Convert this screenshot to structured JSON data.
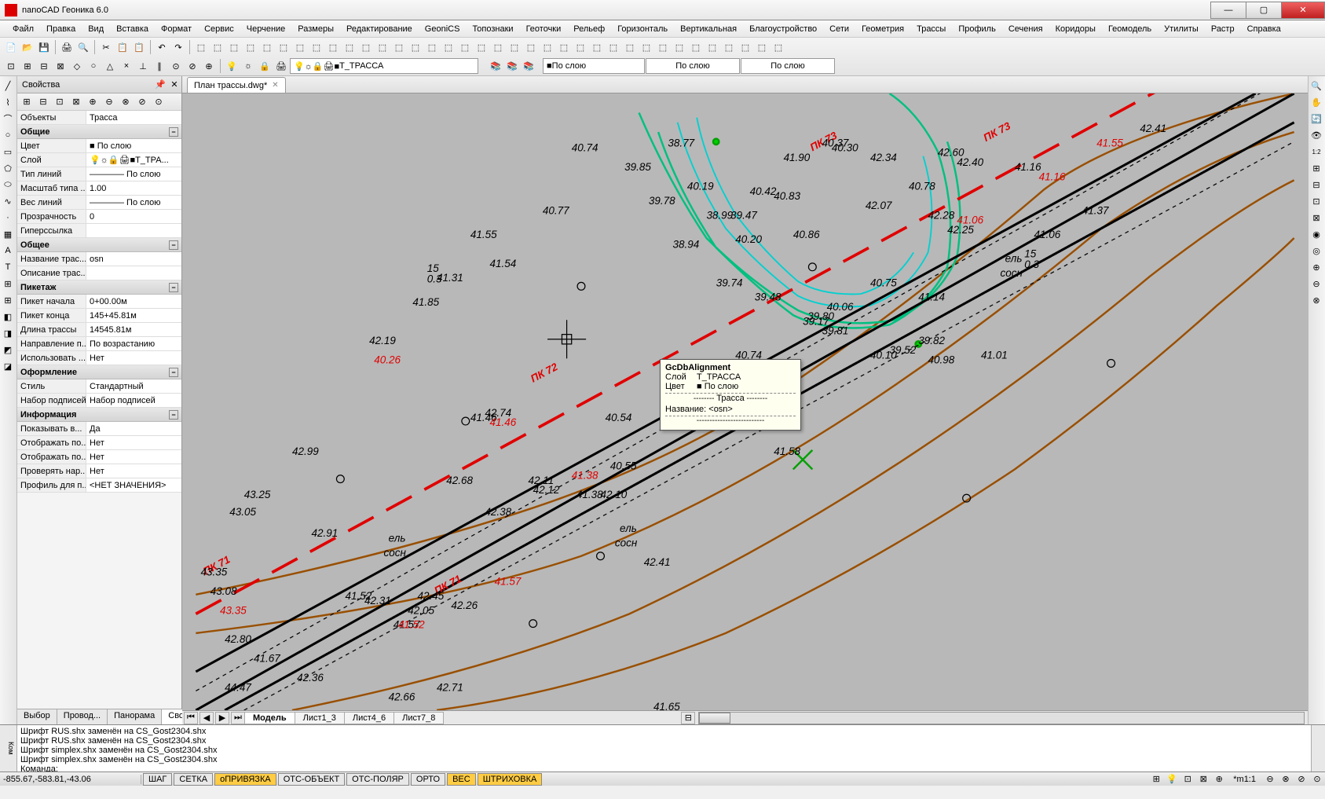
{
  "app": {
    "title": "nanoCAD Геоника 6.0"
  },
  "menu": [
    "Файл",
    "Правка",
    "Вид",
    "Вставка",
    "Формат",
    "Сервис",
    "Черчение",
    "Размеры",
    "Редактирование",
    "GeoniCS",
    "Топознаки",
    "Геоточки",
    "Рельеф",
    "Горизонталь",
    "Вертикальная",
    "Благоустройство",
    "Сети",
    "Геометрия",
    "Трассы",
    "Профиль",
    "Сечения",
    "Коридоры",
    "Геомодель",
    "Утилиты",
    "Растр",
    "Справка"
  ],
  "layer_combo": "Т_ТРАССА",
  "linetype_combo": "По слою",
  "color_combo": "По слою",
  "lineweight_combo": "По слою",
  "doc_tab": "План трассы.dwg*",
  "props": {
    "title": "Свойства",
    "object_label": "Объекты",
    "object_value": "Трасса",
    "sections": [
      {
        "name": "Общие",
        "rows": [
          {
            "l": "Цвет",
            "v": "■ По слою"
          },
          {
            "l": "Слой",
            "v": "💡☼🔒🖨■Т_ТРА..."
          },
          {
            "l": "Тип линий",
            "v": "———— По слою"
          },
          {
            "l": "Масштаб типа ...",
            "v": "1.00"
          },
          {
            "l": "Вес линий",
            "v": "———— По слою"
          },
          {
            "l": "Прозрачность",
            "v": "0"
          },
          {
            "l": "Гиперссылка",
            "v": ""
          }
        ]
      },
      {
        "name": "Общее",
        "rows": [
          {
            "l": "Название трас...",
            "v": "osn"
          },
          {
            "l": "Описание трас...",
            "v": ""
          }
        ]
      },
      {
        "name": "Пикетаж",
        "rows": [
          {
            "l": "Пикет начала",
            "v": "0+00.00м"
          },
          {
            "l": "Пикет конца",
            "v": "145+45.81м"
          },
          {
            "l": "Длина трассы",
            "v": "14545.81м"
          },
          {
            "l": "Направление п...",
            "v": "По возрастанию"
          },
          {
            "l": "Использовать ...",
            "v": "Нет"
          }
        ]
      },
      {
        "name": "Оформление",
        "rows": [
          {
            "l": "Стиль",
            "v": "Стандартный"
          },
          {
            "l": "Набор подписей",
            "v": "Набор подписей"
          }
        ]
      },
      {
        "name": "Информация",
        "rows": [
          {
            "l": "Показывать в...",
            "v": "Да"
          },
          {
            "l": "Отображать по...",
            "v": "Нет"
          },
          {
            "l": "Отображать по...",
            "v": "Нет"
          },
          {
            "l": "Проверять нар...",
            "v": "Нет"
          },
          {
            "l": "Профиль для п...",
            "v": "<НЕТ ЗНАЧЕНИЯ>"
          }
        ]
      }
    ],
    "tabs": [
      "Выбор",
      "Провод...",
      "Панорама",
      "Свойства"
    ],
    "active_tab": 3
  },
  "tooltip": {
    "title": "GcDbAlignment",
    "rows": [
      {
        "l": "Слой",
        "v": "Т_ТРАССА"
      },
      {
        "l": "Цвет",
        "v": "■ По слою"
      }
    ],
    "sep": "Трасса",
    "name_row": "Название: <osn>"
  },
  "bottom_tabs": [
    "Модель",
    "Лист1_3",
    "Лист4_6",
    "Лист7_8"
  ],
  "cmd_lines": [
    "Шрифт RUS.shx заменён на CS_Gost2304.shx",
    "Шрифт RUS.shx заменён на CS_Gost2304.shx",
    "Шрифт simplex.shx заменён на CS_Gost2304.shx",
    "Шрифт simplex.shx заменён на CS_Gost2304.shx"
  ],
  "cmd_prompt": "Команда:",
  "status": {
    "coords": "-855.67,-583.81,-43.06",
    "buttons": [
      {
        "t": "ШАГ",
        "on": false
      },
      {
        "t": "СЕТКА",
        "on": false
      },
      {
        "t": "оПРИВЯЗКА",
        "on": true
      },
      {
        "t": "ОТС-ОБЪЕКТ",
        "on": false
      },
      {
        "t": "ОТС-ПОЛЯР",
        "on": false
      },
      {
        "t": "ОРТО",
        "on": false
      },
      {
        "t": "ВЕС",
        "on": true
      },
      {
        "t": "ШТРИХОВКА",
        "on": true
      }
    ],
    "scale": "*m1:1"
  },
  "canvas_labels": {
    "pk71": "ПК 71",
    "pk72": "ПК 72",
    "pk73": "ПК 73",
    "elevations": [
      "40.74",
      "39.85",
      "38.77",
      "40.19",
      "39.78",
      "40.77",
      "40.20",
      "42.19",
      "42.99",
      "43.25",
      "42.74",
      "42.68",
      "42.91",
      "43.08",
      "42.80",
      "41.67",
      "42.36",
      "42.66",
      "42.71",
      "42.31",
      "42.05",
      "42.12",
      "42.26",
      "42.45",
      "42.38",
      "43.05",
      "42.11",
      "41.85",
      "41.31",
      "40.06",
      "39.80",
      "39.81",
      "40.10",
      "40.74",
      "41.16",
      "41.90",
      "42.34",
      "42.60",
      "42.40",
      "42.28",
      "42.25",
      "41.37",
      "40.78",
      "41.58",
      "40.75",
      "41.14",
      "39.74",
      "39.52",
      "39.82",
      "41.54",
      "40.98",
      "42.07",
      "40.37",
      "38.99",
      "39.47",
      "38.94",
      "39.48",
      "39.17",
      "40.42",
      "40.83",
      "40.86",
      "40.55",
      "40.30",
      "41.55",
      "41.57",
      "41.38",
      "41.46",
      "42.10",
      "41.52",
      "40.54",
      "41.65",
      "41.06",
      "41.01",
      "42.41",
      "43.35",
      "44.47"
    ],
    "veg": [
      "ель",
      "сосн"
    ],
    "frac": [
      "15",
      "0.3",
      "5"
    ]
  }
}
